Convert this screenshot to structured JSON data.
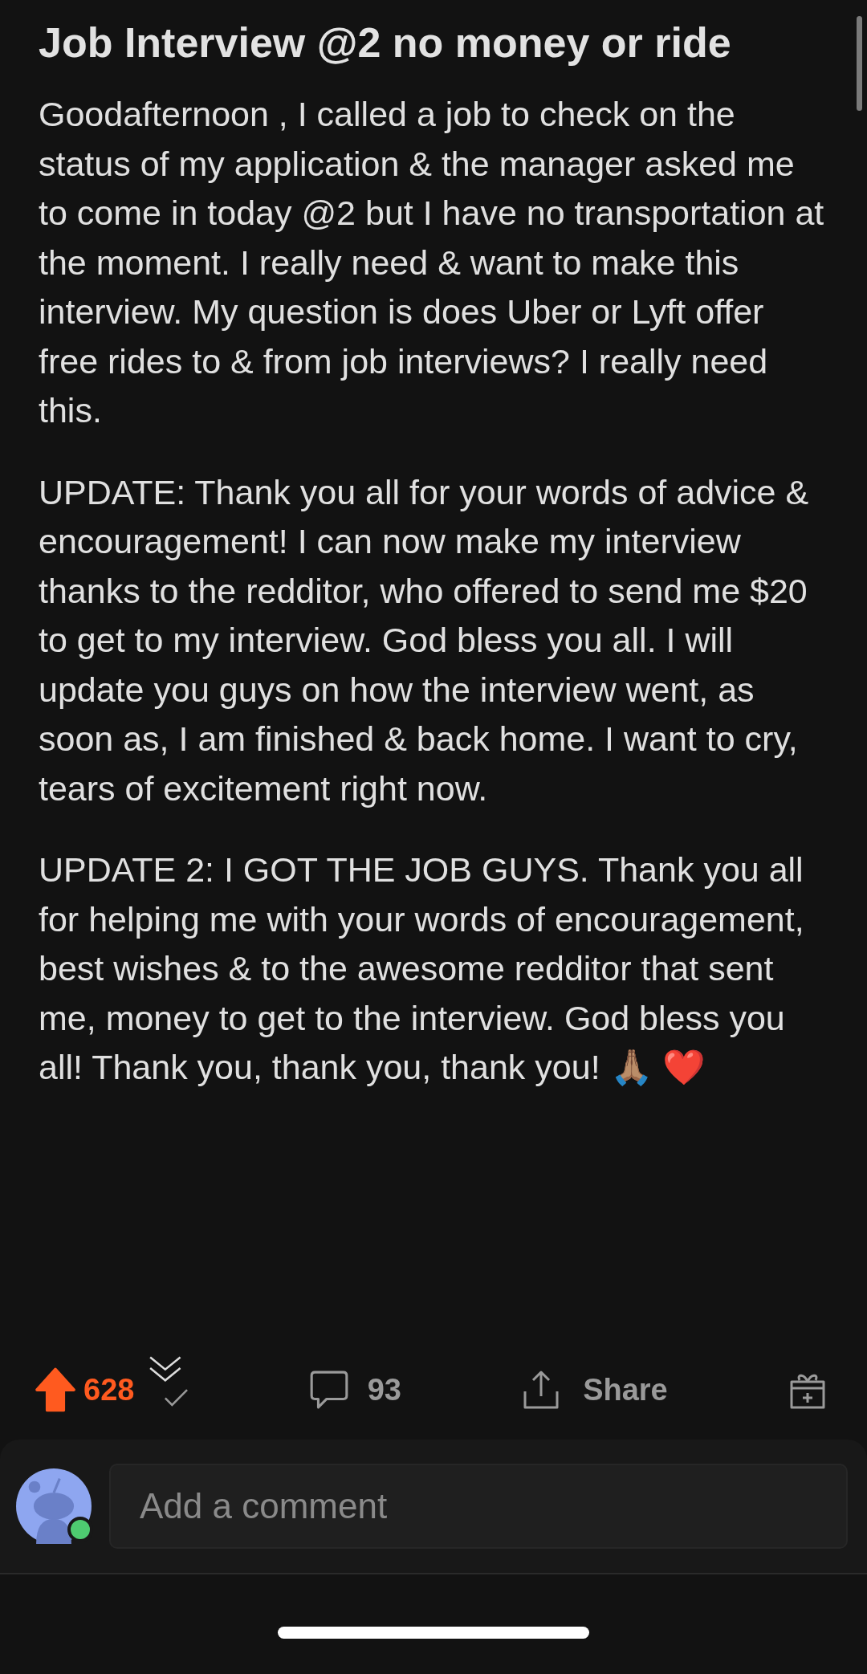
{
  "post": {
    "title": "Job Interview @2 no money or ride",
    "paragraphs": [
      "Goodafternoon , I called a job to check on the status of my application & the manager asked me to come in today @2 but I have no transportation at the moment. I really need & want to make this interview. My question is does Uber or Lyft offer free rides to & from job interviews? I really need this.",
      "UPDATE: Thank you all for your words of advice & encouragement! I can now make my interview thanks to the redditor, who offered to send me $20 to get to my interview. God bless you all. I will update you guys on how the interview went, as soon as, I am finished & back home. I want to cry, tears of excitement right now.",
      "UPDATE 2: I GOT THE JOB GUYS. Thank you all for helping me with your words of encouragement, best wishes & to the awesome redditor that sent me, money to get to the interview. God bless you all! Thank you, thank you, thank you! 🙏🏽 ❤️"
    ]
  },
  "actions": {
    "upvoted": true,
    "score": "628",
    "comments": "93",
    "share": "Share"
  },
  "comment_bar": {
    "placeholder": "Add a comment",
    "online": true
  }
}
